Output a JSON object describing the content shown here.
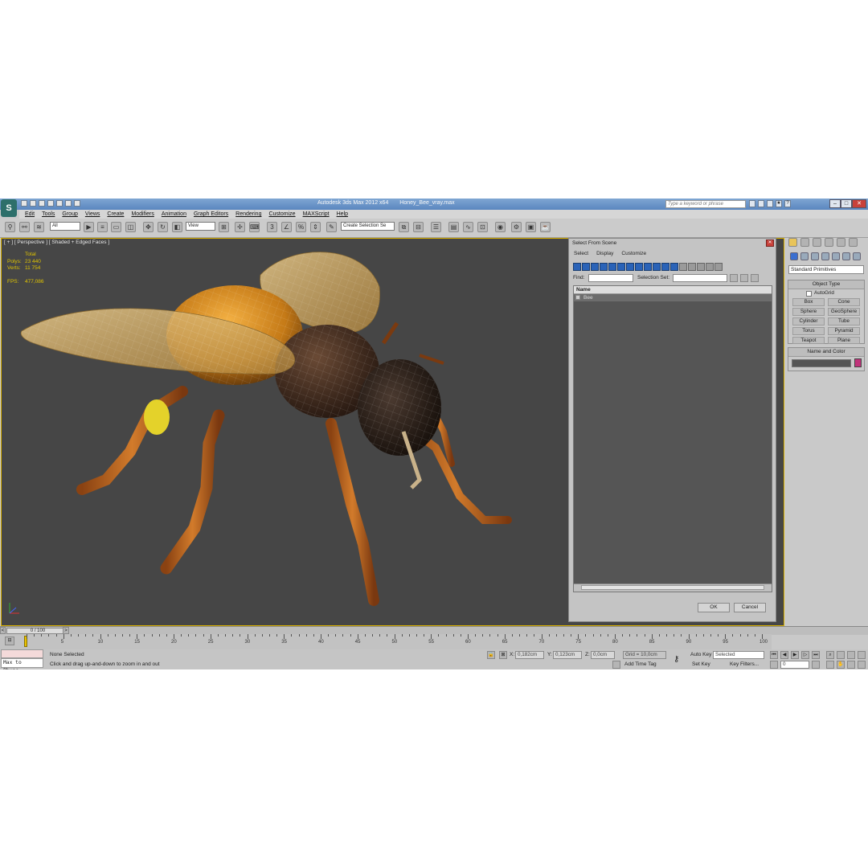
{
  "app": {
    "window_title": "Autodesk 3ds Max 2012 x64",
    "file_name": "Honey_Bee_vray.max",
    "logo_letter": "S",
    "search_placeholder": "Type a keyword or phrase"
  },
  "menu": [
    "Edit",
    "Tools",
    "Group",
    "Views",
    "Create",
    "Modifiers",
    "Animation",
    "Graph Editors",
    "Rendering",
    "Customize",
    "MAXScript",
    "Help"
  ],
  "toolbar": {
    "filter_value": "All",
    "coord_value": "View",
    "selection_set_value": "Create Selection Se",
    "snap_labels": [
      "3",
      "%"
    ]
  },
  "viewport": {
    "label": "[ + ] [ Perspective ] [ Shaded + Edged Faces ]",
    "stats_header": "Total",
    "stats": [
      {
        "key": "Polys:",
        "value": "23 440"
      },
      {
        "key": "Verts:",
        "value": "11 754"
      }
    ],
    "fps_key": "FPS:",
    "fps_value": "477,086",
    "accent_color": "#d9b100"
  },
  "dialog": {
    "title": "Select From Scene",
    "menu": [
      "Select",
      "Display",
      "Customize"
    ],
    "find_label": "Find:",
    "selection_set_label": "Selection Set:",
    "column_name": "Name",
    "rows": [
      "Bee"
    ],
    "ok_label": "OK",
    "cancel_label": "Cancel"
  },
  "command_panel": {
    "category": "Standard Primitives",
    "object_type_title": "Object Type",
    "autogrid_label": "AutoGrid",
    "object_buttons": [
      "Box",
      "Cone",
      "Sphere",
      "GeoSphere",
      "Cylinder",
      "Tube",
      "Torus",
      "Pyramid",
      "Teapot",
      "Plane"
    ],
    "name_color_title": "Name and Color",
    "swatch_color": "#c0337a"
  },
  "timeline": {
    "slider_label": "0 / 100",
    "ruler_labels": [
      "5",
      "10",
      "15",
      "20",
      "25",
      "30",
      "35",
      "40",
      "45",
      "50",
      "55",
      "60",
      "65",
      "70",
      "75",
      "80",
      "85",
      "90",
      "95",
      "100"
    ]
  },
  "status": {
    "maxscript_text": "Max to Physc.",
    "selection": "None Selected",
    "prompt": "Click and drag up-and-down to zoom in and out",
    "x_label": "X:",
    "x_value": "0,182cm",
    "y_label": "Y:",
    "y_value": "0,123cm",
    "z_label": "Z:",
    "z_value": "0,0cm",
    "grid": "Grid = 10,0cm",
    "add_time_tag": "Add Time Tag",
    "auto_key": "Auto Key",
    "set_key": "Set Key",
    "key_mode_value": "Selected",
    "key_filters": "Key Filters...",
    "frame_value": "0"
  }
}
